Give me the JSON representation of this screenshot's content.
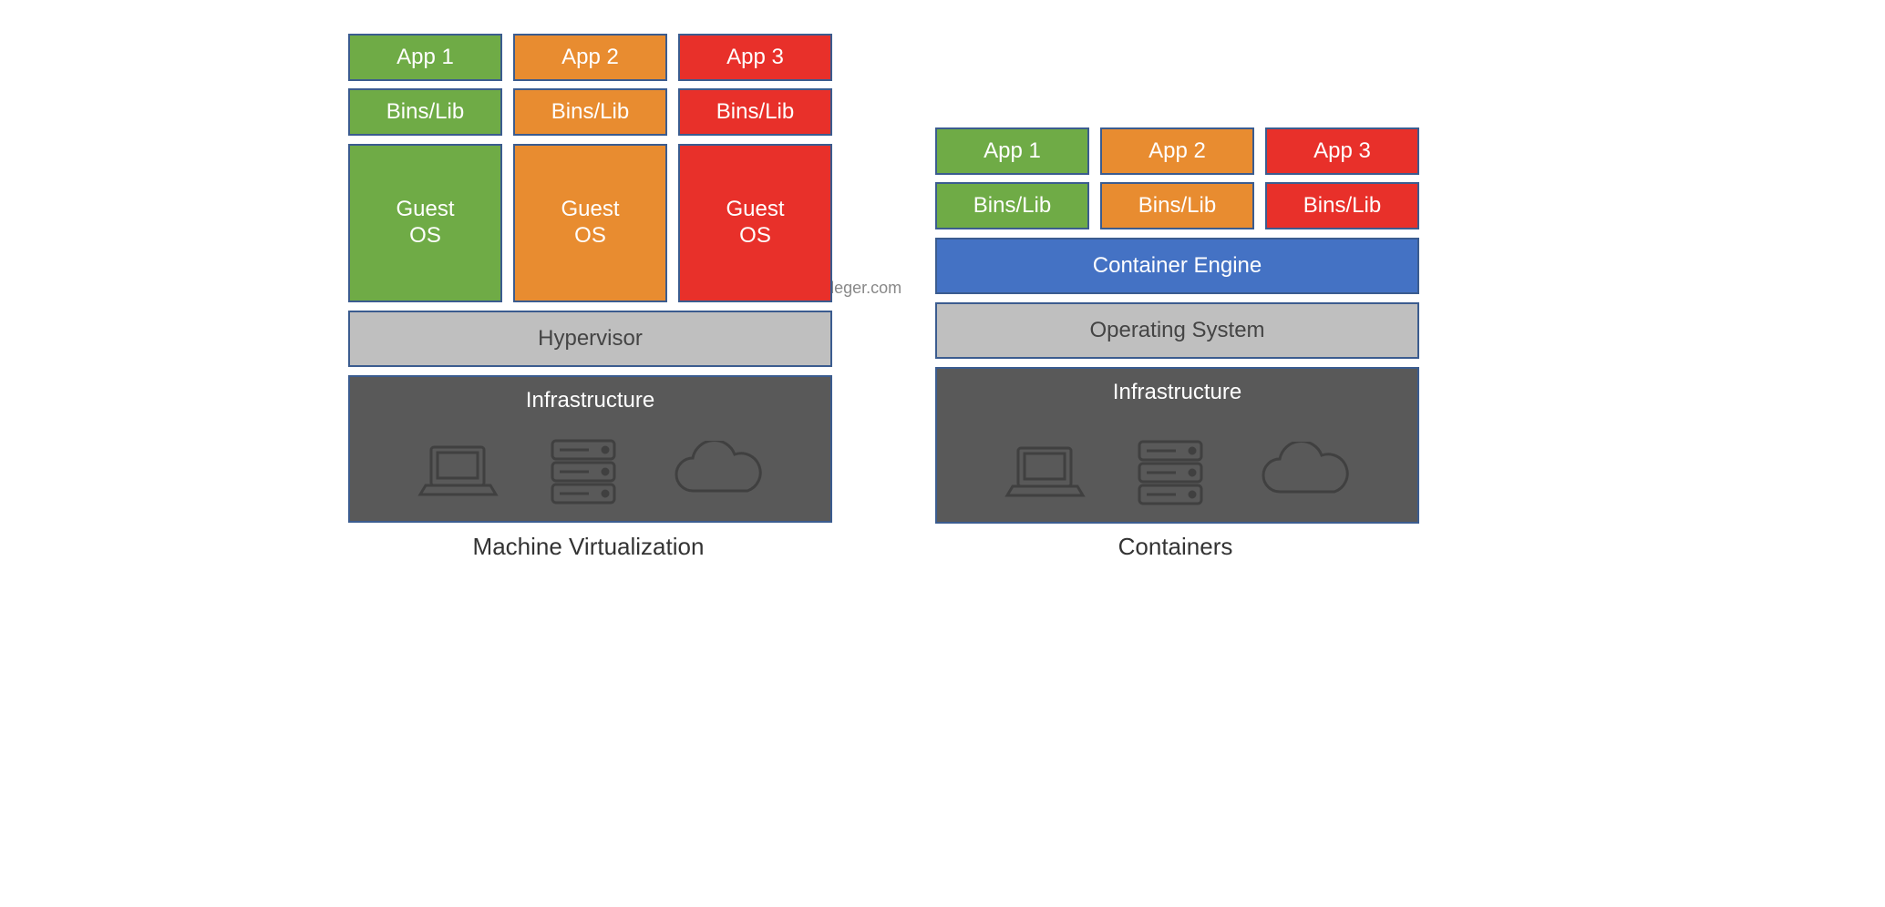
{
  "watermark": "https://www.tayfundeger.com",
  "colors": {
    "border": "#3b5c8f",
    "green": "#6fab46",
    "orange": "#e88c30",
    "red": "#e8302a",
    "blue": "#4472c4",
    "lightgray": "#bfbfbf",
    "darkgray": "#595959"
  },
  "left": {
    "title": "Machine Virtualization",
    "apps": [
      "App 1",
      "App 2",
      "App 3"
    ],
    "bins": "Bins/Lib",
    "guest": "Guest OS",
    "hypervisor": "Hypervisor",
    "infrastructure": "Infrastructure",
    "icons": [
      "laptop",
      "server",
      "cloud"
    ]
  },
  "right": {
    "title": "Containers",
    "apps": [
      "App 1",
      "App 2",
      "App 3"
    ],
    "bins": "Bins/Lib",
    "engine": "Container Engine",
    "os": "Operating System",
    "infrastructure": "Infrastructure",
    "icons": [
      "laptop",
      "server",
      "cloud"
    ]
  }
}
